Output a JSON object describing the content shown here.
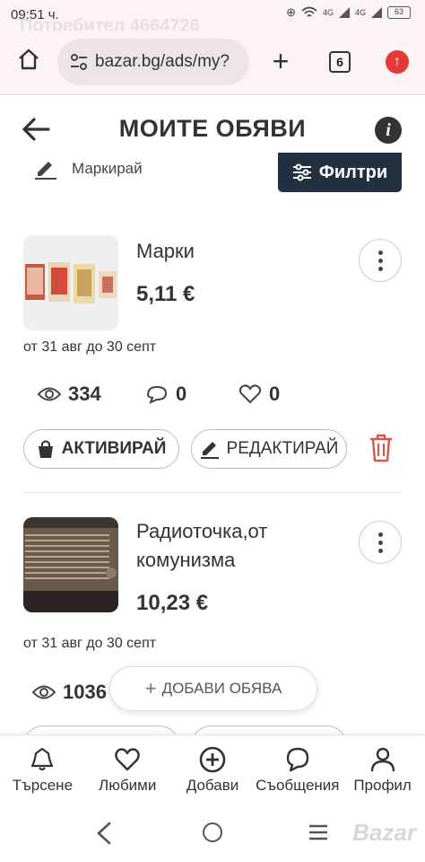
{
  "status_bar": {
    "time": "09:51 ч.",
    "watermark": "Потребител 4664726",
    "net1": "4G",
    "net2": "4G",
    "battery": "63"
  },
  "browser": {
    "url": "bazar.bg/ads/my?",
    "tab_count": "6"
  },
  "header": {
    "title": "МОИТЕ ОБЯВИ",
    "mark_label": "Маркирай",
    "filter_label": "Филтри"
  },
  "ads": [
    {
      "title": "Марки",
      "price": "5,11 €",
      "dates": "от 31 авг до 30 септ",
      "views": "334",
      "messages": "0",
      "favorites": "0",
      "activate_label": "АКТИВИРАЙ",
      "edit_label": "РЕДАКТИРАЙ"
    },
    {
      "title": "Радиоточка,от комунизма",
      "price": "10,23 €",
      "dates": "от 31 авг до 30 септ",
      "views": "1036"
    }
  ],
  "fab": {
    "label": "ДОБАВИ ОБЯВА"
  },
  "bottom_nav": [
    {
      "label": "Търсене",
      "icon": "bell-icon"
    },
    {
      "label": "Любими",
      "icon": "heart-icon"
    },
    {
      "label": "Добави",
      "icon": "plus-circle-icon"
    },
    {
      "label": "Съобщения",
      "icon": "chat-icon"
    },
    {
      "label": "Профил",
      "icon": "user-icon"
    }
  ],
  "brand": "Bazar",
  "colors": {
    "accent": "#223140",
    "danger": "#e53935",
    "trash": "#d9534f"
  }
}
